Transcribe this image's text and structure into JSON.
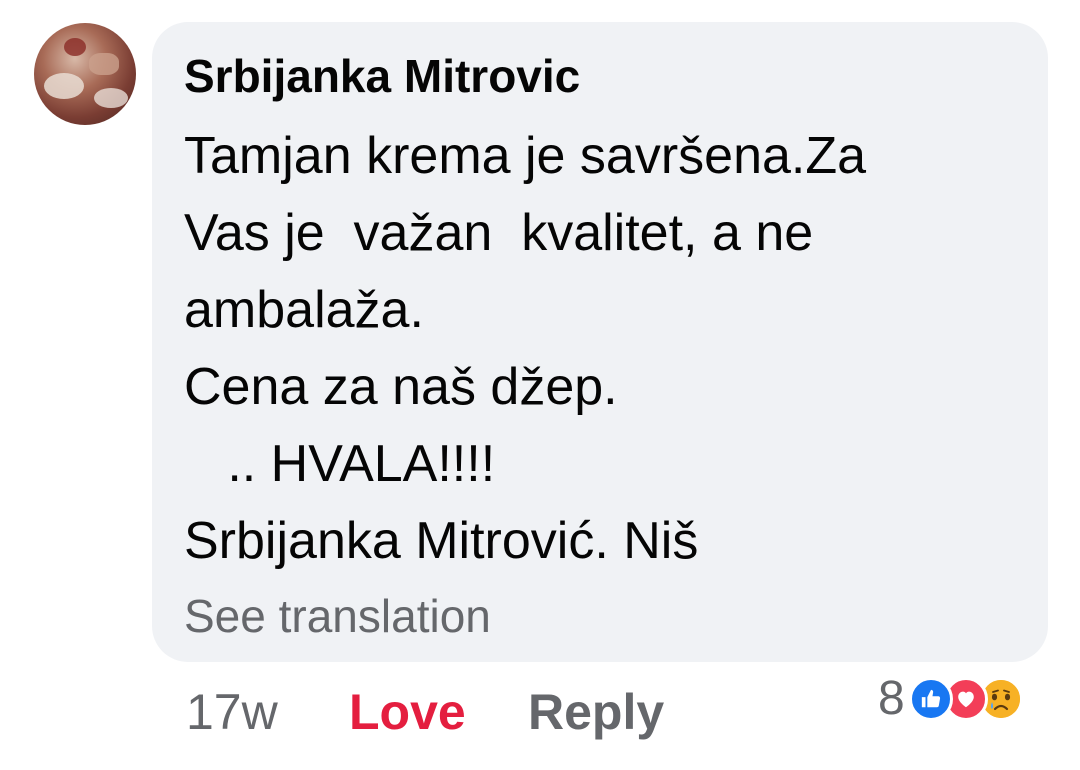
{
  "comment": {
    "author": "Srbijanka Mitrovic",
    "text": "Tamjan krema je savršena.Za\nVas je  važan  kvalitet, a ne\nambalaža.\nCena za naš džep.\n   .. HVALA!!!!\nSrbijanka Mitrović. Niš",
    "see_translation": "See translation"
  },
  "actions": {
    "time": "17w",
    "love": "Love",
    "reply": "Reply"
  },
  "reactions": {
    "count": "8",
    "types": [
      "like-icon",
      "heart-icon",
      "sad-icon"
    ]
  },
  "colors": {
    "bubble": "#f0f2f5",
    "love_active": "#e41e3f",
    "like": "#1877f2",
    "heart": "#f33e58",
    "sad": "#f7b125",
    "secondary_text": "#65676b"
  }
}
